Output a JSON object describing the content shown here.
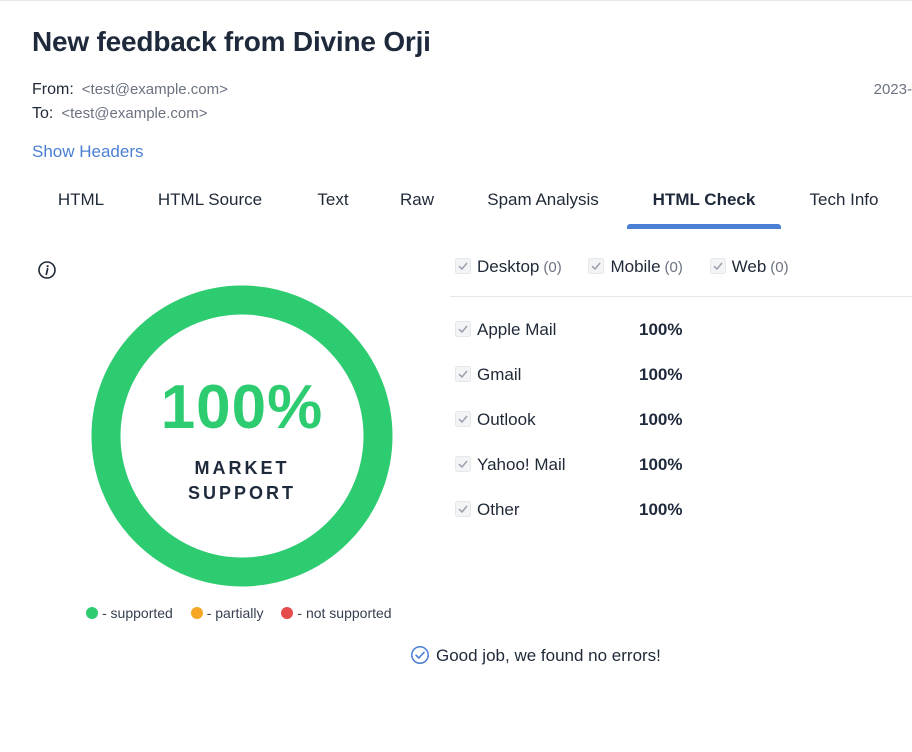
{
  "email": {
    "title": "New feedback from Divine Orji",
    "from_label": "From:",
    "from_address": "<test@example.com>",
    "to_label": "To:",
    "to_address": "<test@example.com>",
    "date": "2023-",
    "show_headers": "Show Headers"
  },
  "tabs": [
    {
      "label": "HTML"
    },
    {
      "label": "HTML Source"
    },
    {
      "label": "Text"
    },
    {
      "label": "Raw"
    },
    {
      "label": "Spam Analysis"
    },
    {
      "label": "HTML Check",
      "active": true
    },
    {
      "label": "Tech Info"
    }
  ],
  "support": {
    "percent": "100%",
    "caption_line1": "MARKET",
    "caption_line2": "SUPPORT",
    "fill_fraction": 1.0,
    "color": "#2ecc71"
  },
  "legend": [
    {
      "label": "- supported",
      "color": "#2ecc71"
    },
    {
      "label": "- partially",
      "color": "#f5a623"
    },
    {
      "label": "- not supported",
      "color": "#e74c4c"
    }
  ],
  "filters": [
    {
      "label": "Desktop",
      "count": "(0)"
    },
    {
      "label": "Mobile",
      "count": "(0)"
    },
    {
      "label": "Web",
      "count": "(0)"
    }
  ],
  "clients": [
    {
      "name": "Apple Mail",
      "percent": "100%"
    },
    {
      "name": "Gmail",
      "percent": "100%"
    },
    {
      "name": "Outlook",
      "percent": "100%"
    },
    {
      "name": "Yahoo! Mail",
      "percent": "100%"
    },
    {
      "name": "Other",
      "percent": "100%"
    }
  ],
  "result_message": "Good job, we found no errors!",
  "colors": {
    "accent": "#4a7fd4",
    "success": "#2ecc71"
  }
}
